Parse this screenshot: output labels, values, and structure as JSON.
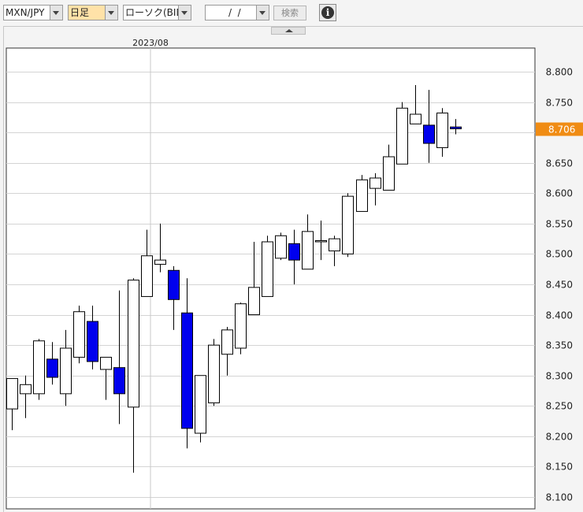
{
  "toolbar": {
    "symbol_select": "MXN/JPY",
    "period_select": "日足",
    "chart_type_select": "ローソク(BID)",
    "date_input": "  /  /",
    "search_button": "検索",
    "info_button": "i"
  },
  "colors": {
    "bull_fill": "#ffffff",
    "bear_fill": "#0000ee",
    "current_price_bg": "#f08c14",
    "period_select_bg": "#ffe2a8"
  },
  "chart_data": {
    "type": "candlestick",
    "x_label": "2023/08",
    "current_price": "8.706",
    "ylim": [
      8.09,
      8.84
    ],
    "yticks": [
      8.8,
      8.75,
      8.7,
      8.65,
      8.6,
      8.55,
      8.5,
      8.45,
      8.4,
      8.35,
      8.3,
      8.25,
      8.2,
      8.15,
      8.1
    ],
    "ytick_labels": [
      "8.800",
      "8.750",
      "8.700",
      "8.650",
      "8.600",
      "8.550",
      "8.500",
      "8.450",
      "8.400",
      "8.350",
      "8.300",
      "8.250",
      "8.200",
      "8.150",
      "8.100"
    ],
    "grid": true,
    "candles": [
      {
        "o": 8.245,
        "h": 8.295,
        "l": 8.21,
        "c": 8.295
      },
      {
        "o": 8.27,
        "h": 8.3,
        "l": 8.23,
        "c": 8.285
      },
      {
        "o": 8.27,
        "h": 8.36,
        "l": 8.26,
        "c": 8.357
      },
      {
        "o": 8.327,
        "h": 8.355,
        "l": 8.285,
        "c": 8.297
      },
      {
        "o": 8.27,
        "h": 8.375,
        "l": 8.25,
        "c": 8.345
      },
      {
        "o": 8.33,
        "h": 8.415,
        "l": 8.32,
        "c": 8.405
      },
      {
        "o": 8.389,
        "h": 8.415,
        "l": 8.31,
        "c": 8.323
      },
      {
        "o": 8.31,
        "h": 8.33,
        "l": 8.26,
        "c": 8.33
      },
      {
        "o": 8.313,
        "h": 8.44,
        "l": 8.22,
        "c": 8.27
      },
      {
        "o": 8.248,
        "h": 8.46,
        "l": 8.14,
        "c": 8.457
      },
      {
        "o": 8.43,
        "h": 8.54,
        "l": 8.43,
        "c": 8.497
      },
      {
        "o": 8.483,
        "h": 8.55,
        "l": 8.47,
        "c": 8.49
      },
      {
        "o": 8.473,
        "h": 8.48,
        "l": 8.375,
        "c": 8.425
      },
      {
        "o": 8.403,
        "h": 8.46,
        "l": 8.18,
        "c": 8.213
      },
      {
        "o": 8.205,
        "h": 8.3,
        "l": 8.19,
        "c": 8.3
      },
      {
        "o": 8.255,
        "h": 8.36,
        "l": 8.25,
        "c": 8.35
      },
      {
        "o": 8.335,
        "h": 8.38,
        "l": 8.3,
        "c": 8.375
      },
      {
        "o": 8.345,
        "h": 8.42,
        "l": 8.335,
        "c": 8.418
      },
      {
        "o": 8.4,
        "h": 8.52,
        "l": 8.4,
        "c": 8.445
      },
      {
        "o": 8.43,
        "h": 8.53,
        "l": 8.43,
        "c": 8.52
      },
      {
        "o": 8.493,
        "h": 8.535,
        "l": 8.49,
        "c": 8.53
      },
      {
        "o": 8.517,
        "h": 8.54,
        "l": 8.45,
        "c": 8.49
      },
      {
        "o": 8.475,
        "h": 8.565,
        "l": 8.475,
        "c": 8.537
      },
      {
        "o": 8.52,
        "h": 8.555,
        "l": 8.49,
        "c": 8.522
      },
      {
        "o": 8.505,
        "h": 8.53,
        "l": 8.48,
        "c": 8.525
      },
      {
        "o": 8.5,
        "h": 8.6,
        "l": 8.495,
        "c": 8.595
      },
      {
        "o": 8.57,
        "h": 8.63,
        "l": 8.57,
        "c": 8.622
      },
      {
        "o": 8.608,
        "h": 8.633,
        "l": 8.58,
        "c": 8.625
      },
      {
        "o": 8.605,
        "h": 8.68,
        "l": 8.605,
        "c": 8.66
      },
      {
        "o": 8.648,
        "h": 8.75,
        "l": 8.648,
        "c": 8.74
      },
      {
        "o": 8.714,
        "h": 8.778,
        "l": 8.714,
        "c": 8.73
      },
      {
        "o": 8.712,
        "h": 8.77,
        "l": 8.65,
        "c": 8.682
      },
      {
        "o": 8.675,
        "h": 8.74,
        "l": 8.66,
        "c": 8.732
      },
      {
        "o": 8.709,
        "h": 8.722,
        "l": 8.697,
        "c": 8.706
      }
    ]
  }
}
